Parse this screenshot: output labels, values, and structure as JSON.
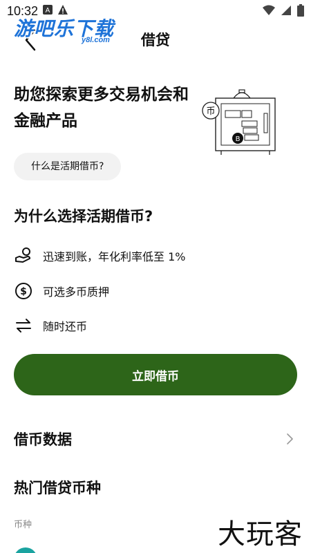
{
  "status_bar": {
    "time": "10:32"
  },
  "watermark": {
    "main": "游吧乐下载",
    "sub": "y8l.com",
    "corner": "大玩客"
  },
  "header": {
    "title": "借贷"
  },
  "hero": {
    "title": "助您探索更多交易机会和金融产品"
  },
  "info_chip": {
    "label": "什么是活期借币?"
  },
  "why": {
    "title": "为什么选择活期借币?",
    "features": [
      {
        "icon": "hand-coin-icon",
        "label": "迅速到账，年化利率低至 1%"
      },
      {
        "icon": "dollar-circle-icon",
        "label": "可选多币质押"
      },
      {
        "icon": "swap-arrows-icon",
        "label": "随时还币"
      }
    ]
  },
  "cta": {
    "label": "立即借币"
  },
  "borrow_data": {
    "title": "借币数据"
  },
  "hot": {
    "title": "热门借贷币种",
    "column_label": "币种"
  },
  "colors": {
    "primary": "#2d6519",
    "chip_bg": "#f2f2f2",
    "watermark_blue": "#1e73d8"
  }
}
